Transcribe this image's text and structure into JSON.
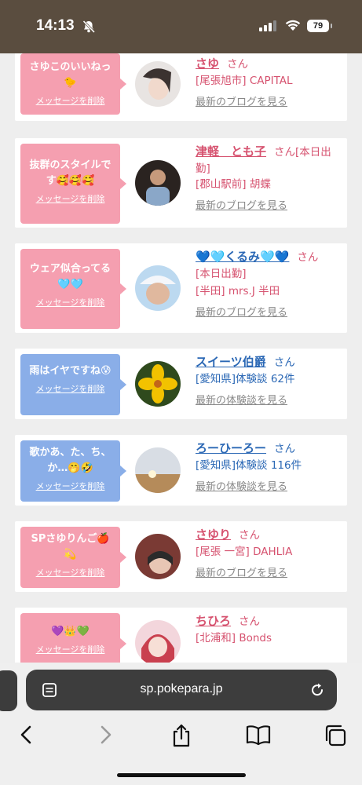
{
  "status": {
    "time": "14:13",
    "battery": "79"
  },
  "cards": [
    {
      "color": "pink",
      "message": "さゆこのいいねっ🐤",
      "delete_label": "メッセージを削除",
      "name": "さゆ",
      "suffix": "さん",
      "line1": "[尾張旭市] CAPITAL",
      "line2": "",
      "link": "最新のブログを見る",
      "avatar_colors": [
        "#e8e4e2",
        "#3b3230"
      ]
    },
    {
      "color": "pink",
      "message": "抜群のスタイルです🥰🥰🥰",
      "delete_label": "メッセージを削除",
      "name": "津軽　とも子",
      "suffix": "さん[本日出勤]",
      "line1": "[郡山駅前] 胡蝶",
      "line2": "",
      "link": "最新のブログを見る",
      "avatar_colors": [
        "#2a2320",
        "#c79a7c"
      ]
    },
    {
      "color": "pink",
      "message": "ウェア似合ってる🩵🩵",
      "delete_label": "メッセージを削除",
      "name": "💙🩵くるみ🩵💙",
      "suffix": "さん",
      "line1": "[本日出勤]",
      "line2": "[半田] mrs.J 半田",
      "link": "最新のブログを見る",
      "avatar_colors": [
        "#bcd9f0",
        "#e0b89e"
      ]
    },
    {
      "color": "blue",
      "message": "雨はイヤですね😰",
      "delete_label": "メッセージを削除",
      "name": "スイーツ伯爵",
      "suffix": "さん",
      "line1": "[愛知県]体験談 62件",
      "line2": "",
      "link": "最新の体験談を見る",
      "avatar_colors": [
        "#2f4a1d",
        "#f2c200"
      ]
    },
    {
      "color": "blue",
      "message": "歌かあ、た、ち、か…🤭🤣",
      "delete_label": "メッセージを削除",
      "name": "ろーひーろー",
      "suffix": "さん",
      "line1": "[愛知県]体験談 116件",
      "line2": "",
      "link": "最新の体験談を見る",
      "avatar_colors": [
        "#d8dde4",
        "#b58b5a"
      ]
    },
    {
      "color": "pink",
      "message": "SPさゆりんご🍎💫",
      "delete_label": "メッセージを削除",
      "name": "さゆり",
      "suffix": "さん",
      "line1": "[尾張 一宮] DAHLIA",
      "line2": "",
      "link": "最新のブログを見る",
      "avatar_colors": [
        "#7a3a34",
        "#2b2b2b"
      ]
    },
    {
      "color": "pink",
      "message": "💜👑💚",
      "delete_label": "メッセージを削除",
      "name": "ちひろ",
      "suffix": "さん",
      "line1": "[北浦和] Bonds",
      "line2": "",
      "link": "",
      "avatar_colors": [
        "#f3d6dc",
        "#c9404f"
      ]
    }
  ],
  "browser": {
    "url": "sp.pokepara.jp"
  }
}
